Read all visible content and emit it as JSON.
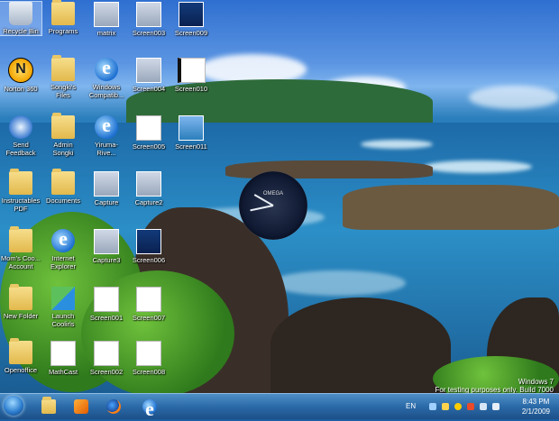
{
  "desktop": {
    "icons": {
      "recycle_bin": "Recycle Bin",
      "programs": "Programs",
      "matrix": "matrix",
      "screen003": "Screen003",
      "screen009": "Screen009",
      "norton360": "Norton 360",
      "songkis_files": "Songki's Files",
      "windows_compat": "Windows Compatib...",
      "screen004": "Screen004",
      "screen010": "Screen010",
      "send_feedback": "Send Feedback",
      "admin_songki": "Admin Songki",
      "yiruma": "Yiruma-Rive...",
      "screen005": "Screen005",
      "screen011": "Screen011",
      "instructables": "Instructables PDF",
      "documents": "Documents",
      "capture": "Capture",
      "capture2": "Capture2",
      "moms_account": "Mom's Coo... Account",
      "internet_explorer": "Internet Explorer",
      "capture3": "Capture3",
      "screen006": "Screen006",
      "new_folder": "New Folder",
      "launch_coolirls": "Launch Coolirls",
      "screen001": "Screen001",
      "screen007": "Screen007",
      "openoffice": "Openoffice",
      "mathcast": "MathCast",
      "screen002": "Screen002",
      "screen008": "Screen008"
    },
    "gadget": {
      "clock_brand": "OMEGA"
    },
    "watermark": {
      "line1": "Windows 7",
      "line2": "For testing purposes only. Build 7000"
    }
  },
  "taskbar": {
    "language": "EN",
    "time": "8:43 PM",
    "date": "2/1/2009",
    "colors": {
      "bar": "#2b6aa8",
      "start_orb": "#2e7fd0"
    }
  }
}
